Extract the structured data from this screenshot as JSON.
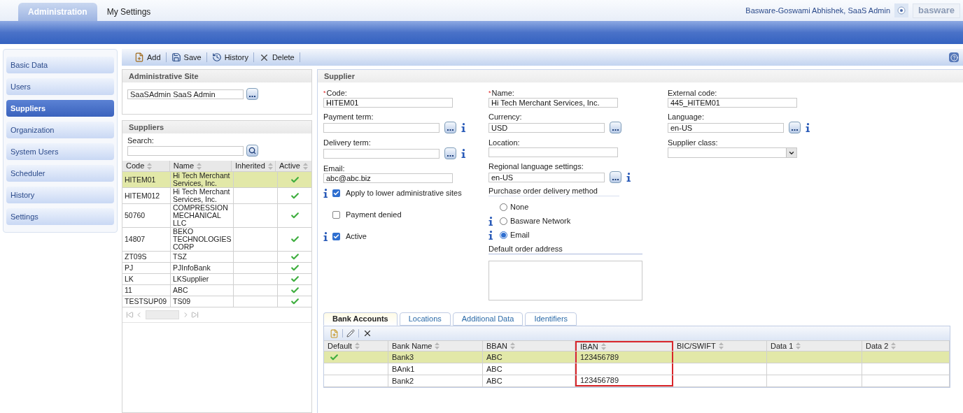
{
  "top_tabs": [
    {
      "label": "Administration",
      "selected": true
    },
    {
      "label": "My Settings",
      "selected": false
    }
  ],
  "user": "Basware-Goswami Abhishek, SaaS Admin",
  "logo": "basware",
  "sidebar": {
    "items": [
      {
        "label": "Basic Data",
        "selected": false
      },
      {
        "label": "Users",
        "selected": false
      },
      {
        "label": "Suppliers",
        "selected": true
      },
      {
        "label": "Organization",
        "selected": false
      },
      {
        "label": "System Users",
        "selected": false
      },
      {
        "label": "Scheduler",
        "selected": false
      },
      {
        "label": "History",
        "selected": false
      },
      {
        "label": "Settings",
        "selected": false
      }
    ]
  },
  "toolbar": [
    {
      "label": "Add",
      "kind": "add"
    },
    {
      "label": "Save",
      "kind": "save"
    },
    {
      "label": "History",
      "kind": "history"
    },
    {
      "label": "Delete",
      "kind": "delete"
    }
  ],
  "admin_site": {
    "title": "Administrative Site",
    "value": "SaaSAdmin SaaS Admin"
  },
  "suppliers": {
    "title": "Suppliers",
    "search_label": "Search:",
    "columns": [
      "Code",
      "Name",
      "Inherited",
      "Active"
    ],
    "rows": [
      {
        "code": "HITEM01",
        "name": "Hi Tech Merchant Services, Inc.",
        "active": true,
        "selected": true
      },
      {
        "code": "HITEM012",
        "name": "Hi Tech Merchant Services, Inc.",
        "active": true,
        "selected": false
      },
      {
        "code": "50760",
        "name": "COMPRESSION MECHANICAL LLC",
        "active": true,
        "selected": false
      },
      {
        "code": "14807",
        "name": "BEKO TECHNOLOGIES CORP",
        "active": true,
        "selected": false
      },
      {
        "code": "ZT09S",
        "name": "TSZ",
        "active": true,
        "selected": false
      },
      {
        "code": "PJ",
        "name": "PJInfoBank",
        "active": true,
        "selected": false
      },
      {
        "code": "LK",
        "name": "LKSupplier",
        "active": true,
        "selected": false
      },
      {
        "code": "11",
        "name": "ABC",
        "active": true,
        "selected": false
      },
      {
        "code": "TESTSUP09",
        "name": "TS09",
        "active": true,
        "selected": false
      }
    ]
  },
  "supplier": {
    "title": "Supplier",
    "column_1": {
      "fields": [
        {
          "label": "Code:",
          "kind": "text",
          "value": "HITEM01",
          "required": "*",
          "info": false
        },
        {
          "label": "Payment term:",
          "kind": "lookup",
          "info": true
        },
        {
          "label": "Delivery term:",
          "kind": "lookup",
          "info": true
        },
        {
          "label": "Email:",
          "kind": "text",
          "value": "abc@abc.biz",
          "info": false
        }
      ],
      "checkboxes": [
        {
          "label": "Apply to lower administrative sites",
          "checked": true,
          "info": true
        },
        {
          "label": "Payment denied",
          "checked": false,
          "info": false
        },
        {
          "label": "Active",
          "checked": true,
          "info": true
        }
      ]
    },
    "column_2": {
      "fields": [
        {
          "label": "Name:",
          "kind": "text",
          "value": "Hi Tech Merchant Services, Inc.",
          "required": "*",
          "info": false
        },
        {
          "label": "Currency:",
          "kind": "lookup",
          "value": "USD",
          "info": false
        },
        {
          "label": "Location:",
          "kind": "text",
          "info": false
        },
        {
          "label": "Regional language settings:",
          "kind": "lookup",
          "value": "en-US",
          "info": true
        }
      ],
      "delivery_method": {
        "title": "Purchase order delivery method",
        "options": [
          {
            "label": "None",
            "selected": false,
            "info": false
          },
          {
            "label": "Basware Network",
            "selected": false,
            "info": true
          },
          {
            "label": "Email",
            "selected": true,
            "info": true
          }
        ]
      },
      "default_order_address": {
        "label": "Default order address"
      }
    },
    "column_3": {
      "fields": [
        {
          "label": "External code:",
          "kind": "text",
          "value": "445_HITEM01",
          "info": false
        },
        {
          "label": "Language:",
          "kind": "lookup",
          "value": "en-US",
          "info": true
        },
        {
          "label": "Supplier class:",
          "kind": "select",
          "info": false
        }
      ]
    }
  },
  "detail_tabs": [
    {
      "label": "Bank Accounts",
      "selected": true
    },
    {
      "label": "Locations",
      "selected": false
    },
    {
      "label": "Additional Data",
      "selected": false
    },
    {
      "label": "Identifiers",
      "selected": false
    }
  ],
  "bank_accounts": {
    "columns": [
      {
        "label": "Default",
        "highlighted": false
      },
      {
        "label": "Bank Name",
        "highlighted": false
      },
      {
        "label": "BBAN",
        "highlighted": false
      },
      {
        "label": "IBAN",
        "highlighted": true
      },
      {
        "label": "BIC/SWIFT",
        "highlighted": false
      },
      {
        "label": "Data 1",
        "highlighted": false
      },
      {
        "label": "Data 2",
        "highlighted": false
      }
    ],
    "rows": [
      {
        "default": true,
        "cells": [
          "",
          "Bank3",
          "ABC",
          "123456789",
          "",
          "",
          ""
        ],
        "selected": true
      },
      {
        "default": false,
        "cells": [
          "",
          "BAnk1",
          "ABC",
          "",
          "",
          "",
          ""
        ],
        "selected": false
      },
      {
        "default": false,
        "cells": [
          "",
          "Bank2",
          "ABC",
          "123456789",
          "",
          "",
          ""
        ],
        "selected": false
      }
    ]
  }
}
